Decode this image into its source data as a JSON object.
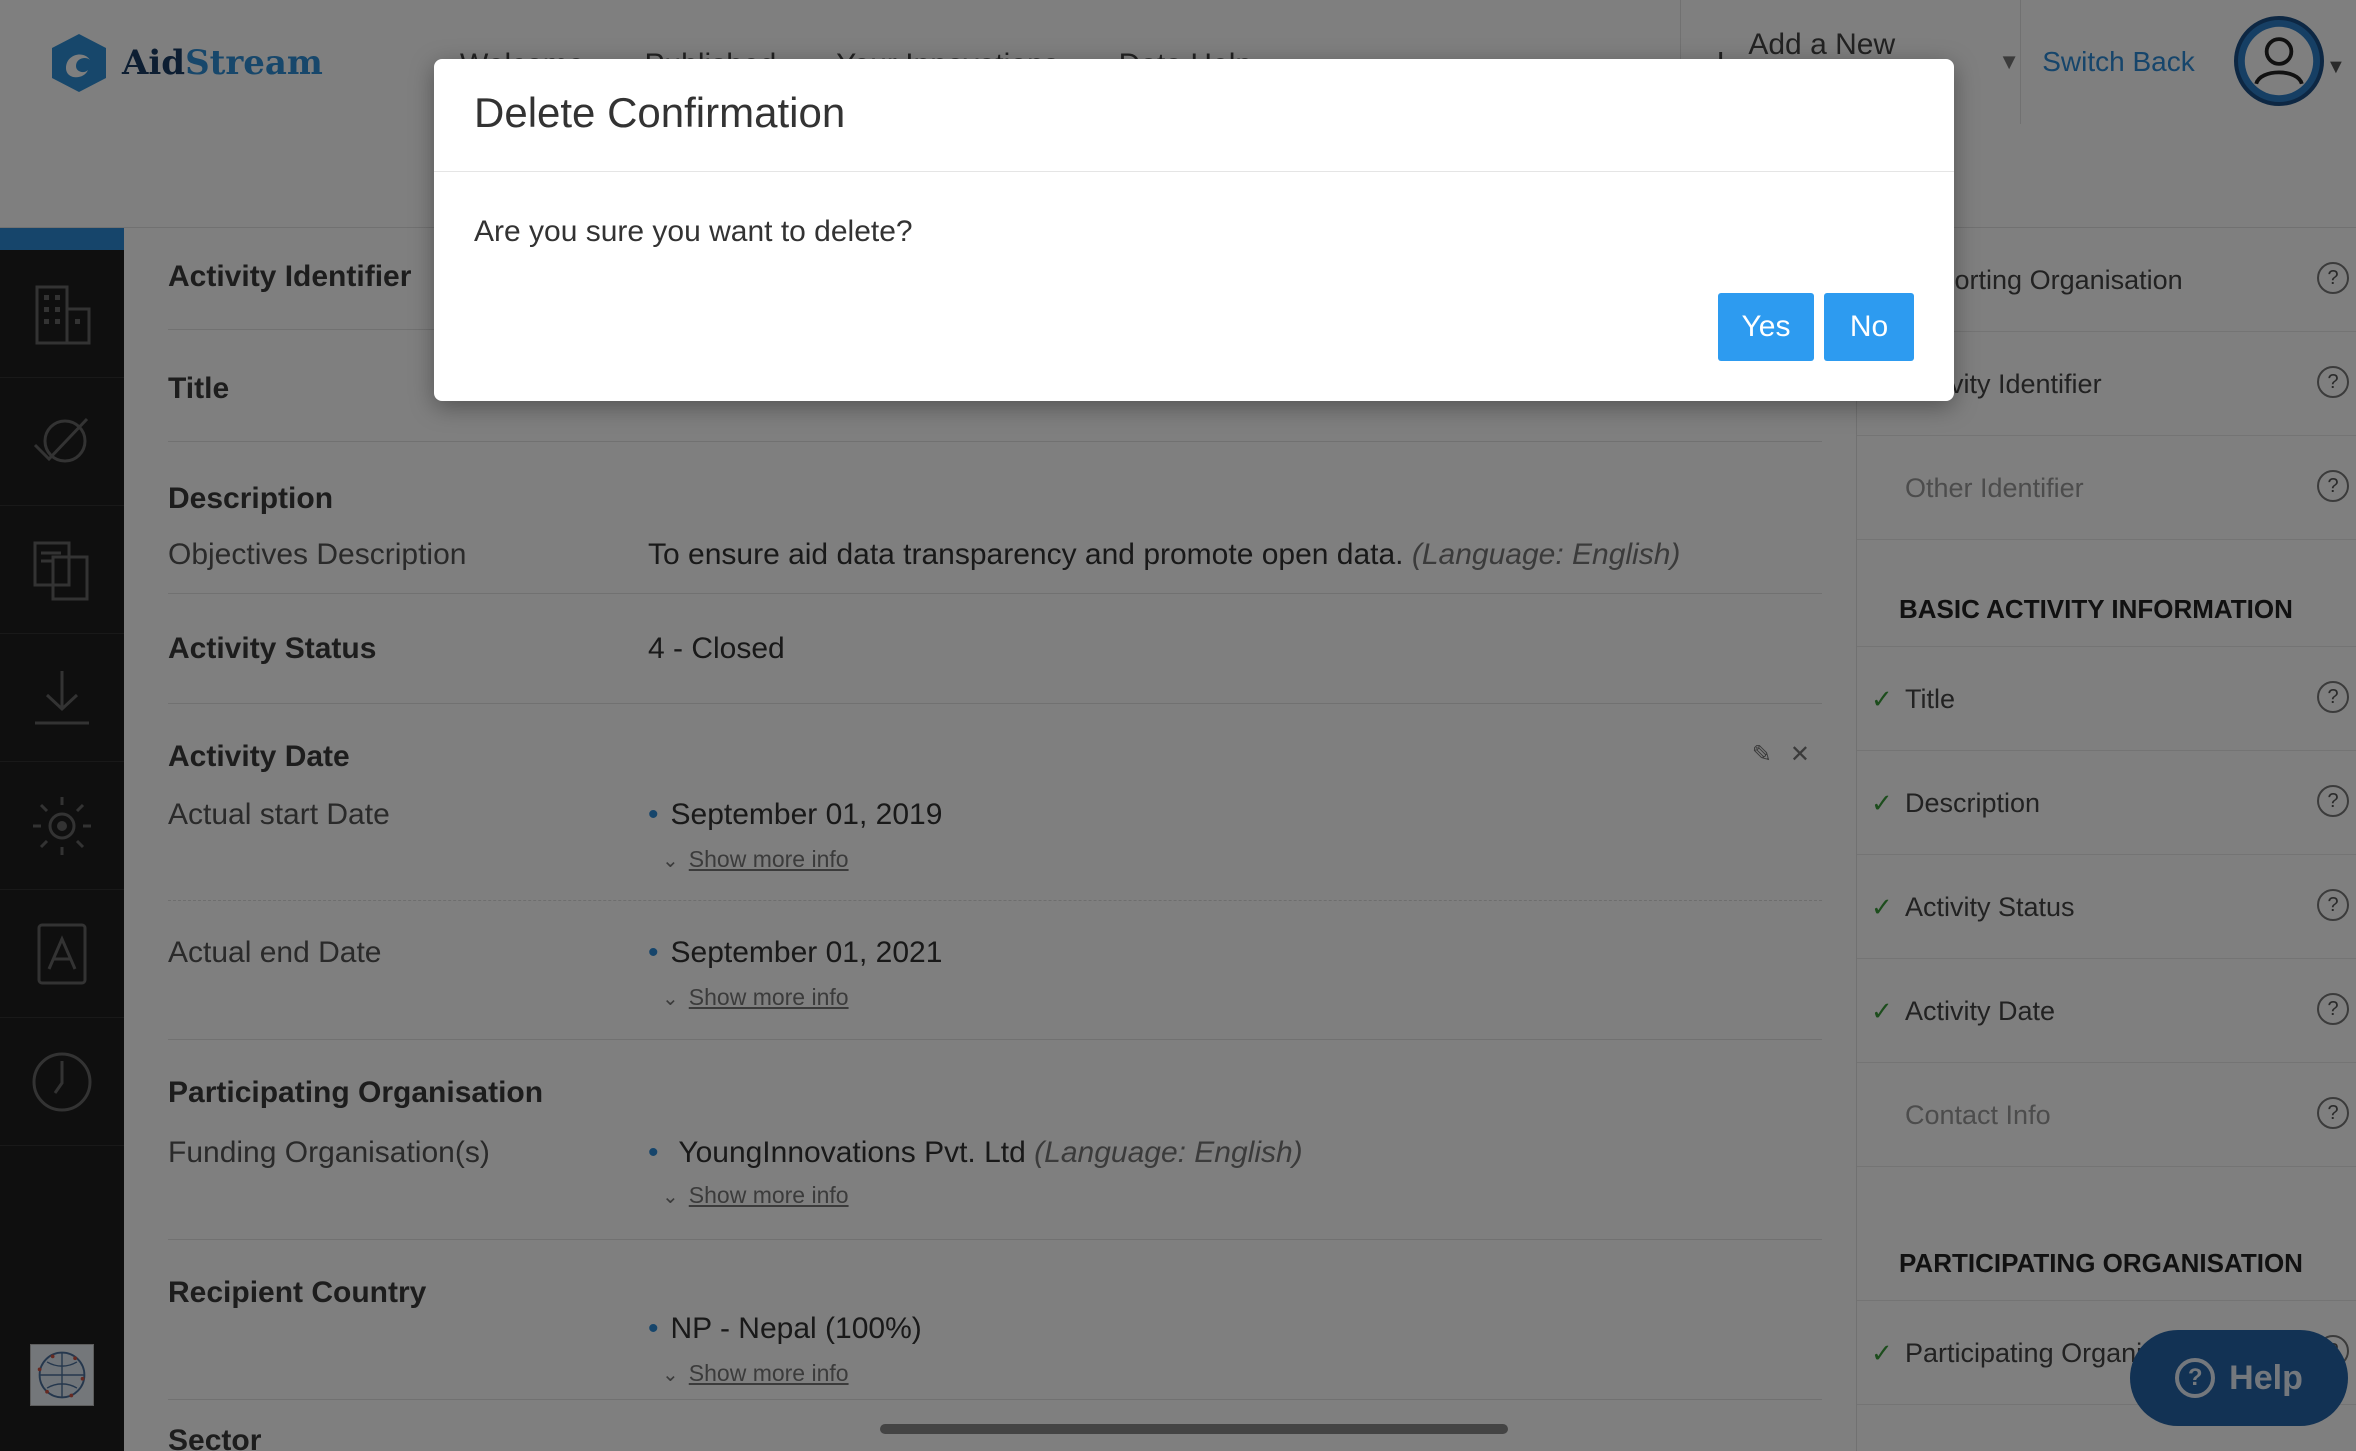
{
  "header": {
    "logo_aid": "Aid",
    "logo_stream": "Stream",
    "nav": [
      "Welcome",
      "Published",
      "Your Innovations",
      "Data Help"
    ],
    "add_activity": "Add a New Activity",
    "switch_back": "Switch Back"
  },
  "main": {
    "activity_identifier": "Activity Identifier",
    "title": "Title",
    "description": {
      "heading": "Description",
      "label": "Objectives Description",
      "value": "To ensure aid data transparency and promote open data.",
      "lang": "(Language: English)"
    },
    "activity_status": {
      "heading": "Activity Status",
      "value": "4 - Closed"
    },
    "activity_date": {
      "heading": "Activity Date",
      "start_label": "Actual start Date",
      "start_value": "September 01, 2019",
      "end_label": "Actual end Date",
      "end_value": "September 01, 2021"
    },
    "participating_org": {
      "heading": "Participating Organisation",
      "label": "Funding Organisation(s)",
      "value": "YoungInnovations Pvt. Ltd",
      "lang": "(Language: English)"
    },
    "recipient_country": {
      "heading": "Recipient Country",
      "value": "NP - Nepal (100%)"
    },
    "sector": "Sector",
    "show_more": "Show more info"
  },
  "right_panel": {
    "items_top": [
      {
        "label": "Reporting Organisation",
        "checked": false
      },
      {
        "label": "Activity Identifier",
        "checked": false
      },
      {
        "label": "Other Identifier",
        "checked": false,
        "muted": true
      }
    ],
    "section_basic": "BASIC ACTIVITY INFORMATION",
    "items_basic": [
      {
        "label": "Title",
        "checked": true
      },
      {
        "label": "Description",
        "checked": true
      },
      {
        "label": "Activity Status",
        "checked": true
      },
      {
        "label": "Activity Date",
        "checked": true
      },
      {
        "label": "Contact Info",
        "checked": false,
        "muted": true
      }
    ],
    "section_participating": "PARTICIPATING ORGANISATION",
    "items_participating": [
      {
        "label": "Participating Organisation",
        "checked": true
      }
    ],
    "help": "Help"
  },
  "modal": {
    "title": "Delete Confirmation",
    "message": "Are you sure you want to delete?",
    "yes": "Yes",
    "no": "No"
  },
  "colors": {
    "accent": "#2d8ad7",
    "button": "#2d9bf0",
    "sidebar": "#1e1e1e",
    "check": "#3a9a3a",
    "help": "#2565a8"
  }
}
